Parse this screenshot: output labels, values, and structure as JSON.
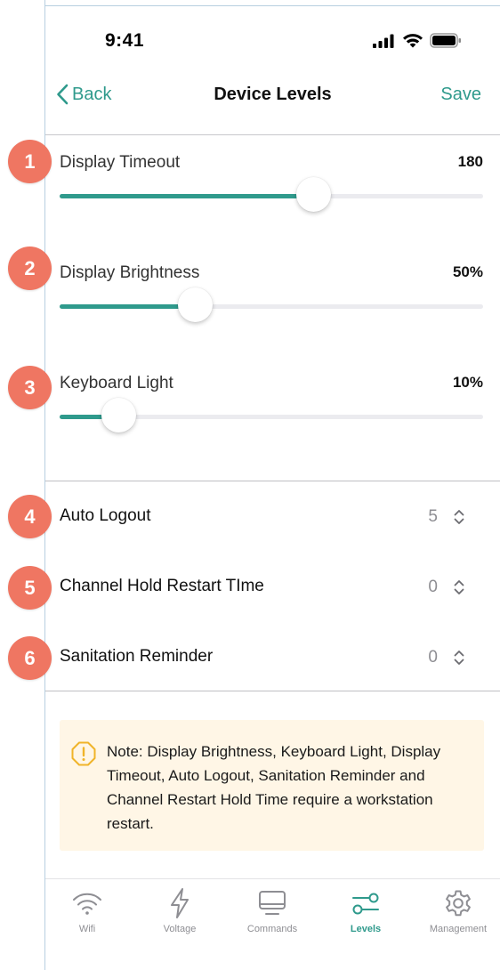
{
  "status_bar": {
    "time": "9:41"
  },
  "nav": {
    "back_label": "Back",
    "title": "Device Levels",
    "save_label": "Save"
  },
  "sliders": [
    {
      "badge": "1",
      "label": "Display Timeout",
      "value_text": "180",
      "fill": 0.6
    },
    {
      "badge": "2",
      "label": "Display Brightness",
      "value_text": "50%",
      "fill": 0.32
    },
    {
      "badge": "3",
      "label": "Keyboard Light",
      "value_text": "10%",
      "fill": 0.14
    }
  ],
  "steppers": [
    {
      "badge": "4",
      "label": "Auto Logout",
      "value": "5"
    },
    {
      "badge": "5",
      "label": "Channel Hold Restart TIme",
      "value": "0"
    },
    {
      "badge": "6",
      "label": "Sanitation Reminder",
      "value": "0"
    }
  ],
  "note": {
    "text": "Note: Display Brightness, Keyboard Light, Display Timeout, Auto Logout, Sanitation Reminder and Channel Restart Hold Time require a workstation restart."
  },
  "tabs": [
    {
      "label": "Wifi",
      "icon": "wifi-icon",
      "active": false
    },
    {
      "label": "Voltage",
      "icon": "lightning-icon",
      "active": false
    },
    {
      "label": "Commands",
      "icon": "monitor-icon",
      "active": false
    },
    {
      "label": "Levels",
      "icon": "sliders-icon",
      "active": true
    },
    {
      "label": "Management",
      "icon": "gear-icon",
      "active": false
    }
  ],
  "colors": {
    "accent": "#2f9a8c",
    "badge": "#ef7662",
    "note_bg": "#fff6e6",
    "note_icon": "#f0b429"
  }
}
